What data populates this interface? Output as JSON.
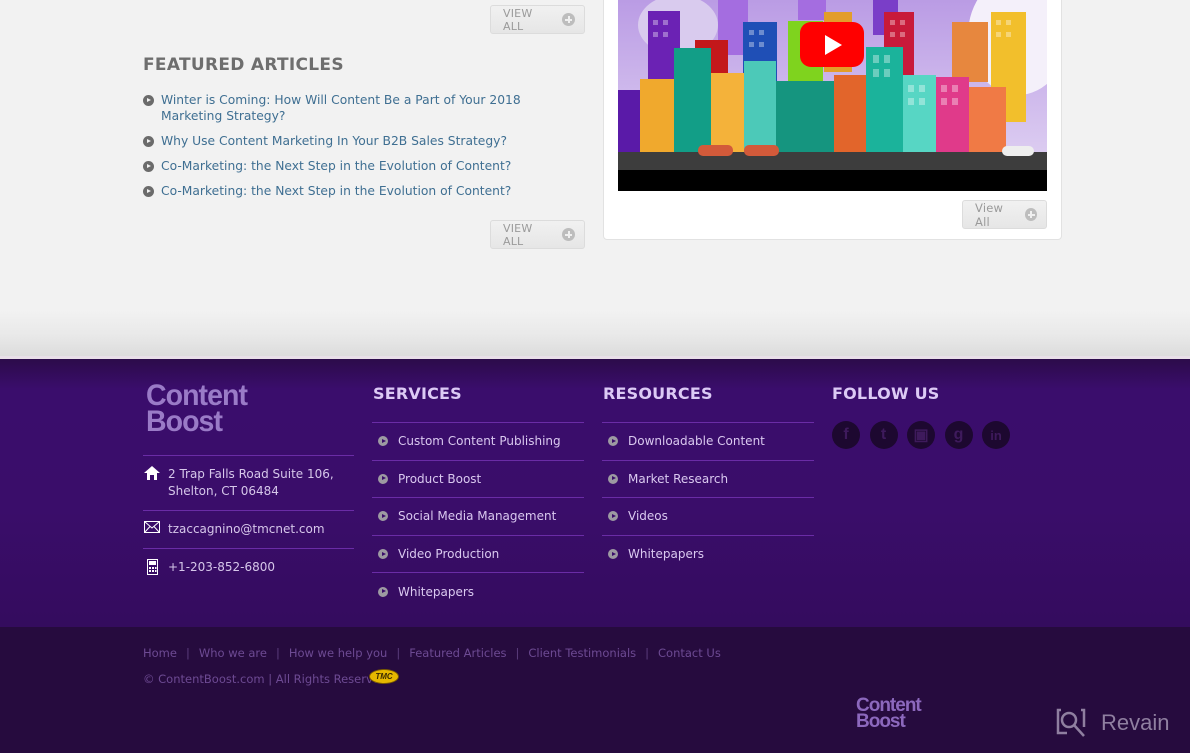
{
  "featured": {
    "title": "FEATURED ARTICLES",
    "view_all_top": "VIEW ALL",
    "view_all_bottom": "VIEW ALL",
    "articles": [
      "Winter is Coming: How Will Content Be a Part of Your 2018 Marketing Strategy?",
      "Why Use Content Marketing In Your B2B Sales Strategy?",
      "Co-Marketing: the Next Step in the Evolution of Content?",
      "Co-Marketing: the Next Step in the Evolution of Content?"
    ]
  },
  "video": {
    "play_icon": "youtube-play-icon",
    "view_all": "View All"
  },
  "footer": {
    "logo": {
      "line1": "Content",
      "line2": "Boost"
    },
    "contact": {
      "address_line1": "2 Trap Falls Road Suite 106,",
      "address_line2": "Shelton, CT 06484",
      "email": "tzaccagnino@tmcnet.com",
      "phone": "+1-203-852-6800"
    },
    "services": {
      "title": "SERVICES",
      "items": [
        "Custom Content Publishing",
        "Product Boost",
        "Social Media Management",
        "Video Production",
        "Whitepapers"
      ]
    },
    "resources": {
      "title": "RESOURCES",
      "items": [
        "Downloadable Content",
        "Market Research",
        "Videos",
        "Whitepapers"
      ]
    },
    "follow": {
      "title": "FOLLOW US",
      "networks": [
        {
          "name": "facebook",
          "glyph": "f"
        },
        {
          "name": "twitter",
          "glyph": "t"
        },
        {
          "name": "youtube",
          "glyph": "▣"
        },
        {
          "name": "google-plus",
          "glyph": "g"
        },
        {
          "name": "linkedin",
          "glyph": "in"
        }
      ]
    }
  },
  "subfooter": {
    "nav": [
      "Home",
      "Who we are",
      "How we help you",
      "Featured Articles",
      "Client Testimonials",
      "Contact Us"
    ],
    "separator": "|",
    "copyright": "© ContentBoost.com | All Rights Reserved",
    "tmc_badge": "TMC",
    "logo": {
      "line1": "Content",
      "line2": "Boost"
    },
    "watermark": "Revain"
  }
}
